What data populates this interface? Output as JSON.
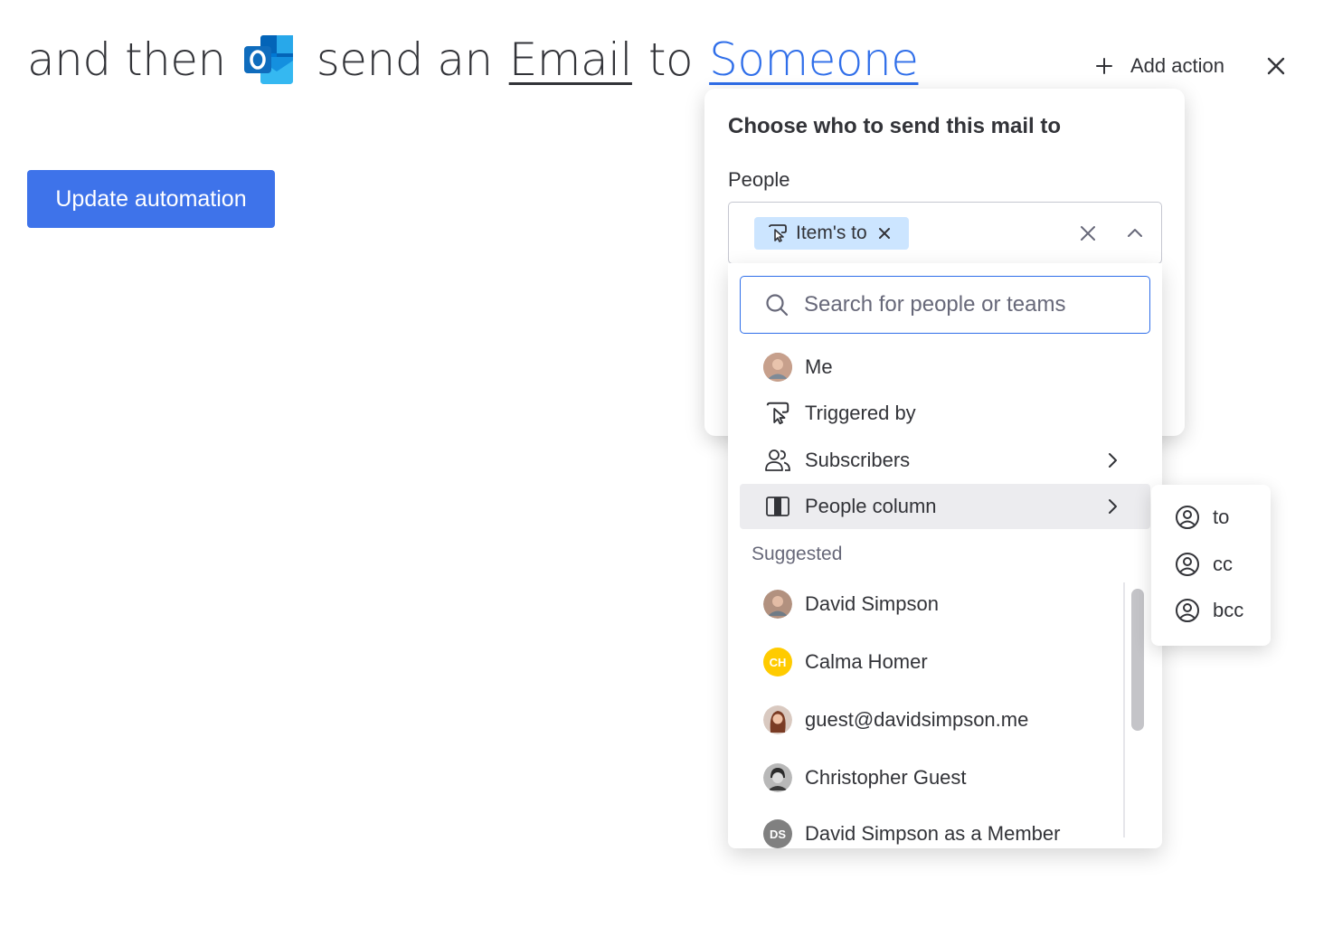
{
  "header": {
    "part1": "and then",
    "part2": "send an",
    "email_link": "Email",
    "part3": "to",
    "recipient_link": "Someone",
    "app_icon": "outlook-icon",
    "add_action_label": "Add action"
  },
  "update_button_label": "Update automation",
  "popover": {
    "title": "Choose who to send this mail to",
    "people_label": "People",
    "selected_chip": "Item's to"
  },
  "menu": {
    "search_placeholder": "Search for people or teams",
    "items": [
      {
        "label": "Me",
        "icon": "user-avatar"
      },
      {
        "label": "Triggered by",
        "icon": "cursor-click-icon"
      },
      {
        "label": "Subscribers",
        "icon": "people-icon",
        "has_submenu": true
      },
      {
        "label": "People column",
        "icon": "column-icon",
        "has_submenu": true,
        "active": true
      }
    ],
    "suggested_label": "Suggested",
    "suggested": [
      {
        "label": "David Simpson"
      },
      {
        "label": "Calma Homer",
        "initials": "CH",
        "color": "#ffcb00"
      },
      {
        "label": "guest@davidsimpson.me"
      },
      {
        "label": "Christopher Guest"
      },
      {
        "label": "David Simpson as a Member",
        "initials": "DS",
        "color": "#808080"
      }
    ]
  },
  "submenu": {
    "items": [
      "to",
      "cc",
      "bcc"
    ]
  },
  "colors": {
    "primary": "#3e73ea",
    "link": "#2f6ee9",
    "chip": "#cce5ff",
    "active_row": "#ececef"
  }
}
